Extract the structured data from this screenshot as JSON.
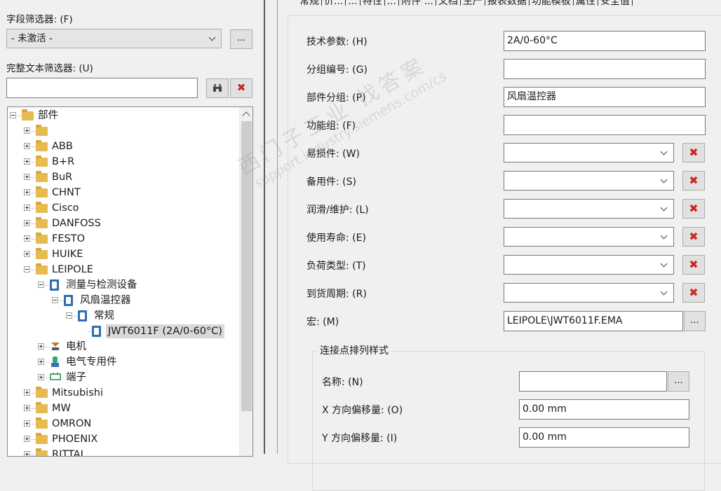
{
  "left": {
    "field_filter": {
      "label": "字段筛选器: (F)",
      "value": "- 未激活 -",
      "more_label": "..."
    },
    "fulltext_filter": {
      "label": "完整文本筛选器: (U)",
      "value": "",
      "binoculars_icon": "binoculars-icon",
      "delete_icon": "✖"
    },
    "tree": [
      {
        "label": "部件",
        "icon": "folder",
        "level": 0,
        "toggle": "minus"
      },
      {
        "label": "",
        "icon": "folder",
        "level": 1,
        "toggle": "plus"
      },
      {
        "label": "ABB",
        "icon": "folder",
        "level": 1,
        "toggle": "plus"
      },
      {
        "label": "B+R",
        "icon": "folder",
        "level": 1,
        "toggle": "plus"
      },
      {
        "label": "BuR",
        "icon": "folder",
        "level": 1,
        "toggle": "plus"
      },
      {
        "label": "CHNT",
        "icon": "folder",
        "level": 1,
        "toggle": "plus"
      },
      {
        "label": "Cisco",
        "icon": "folder",
        "level": 1,
        "toggle": "plus"
      },
      {
        "label": "DANFOSS",
        "icon": "folder",
        "level": 1,
        "toggle": "plus"
      },
      {
        "label": "FESTO",
        "icon": "folder",
        "level": 1,
        "toggle": "plus"
      },
      {
        "label": "HUIKE",
        "icon": "folder",
        "level": 1,
        "toggle": "plus"
      },
      {
        "label": "LEIPOLE",
        "icon": "folder",
        "level": 1,
        "toggle": "minus"
      },
      {
        "label": "测量与检测设备",
        "icon": "part",
        "level": 2,
        "toggle": "minus"
      },
      {
        "label": "风扇温控器",
        "icon": "part",
        "level": 3,
        "toggle": "minus"
      },
      {
        "label": "常规",
        "icon": "part",
        "level": 4,
        "toggle": "minus"
      },
      {
        "label": "JWT6011F (2A/0-60°C)",
        "icon": "part",
        "level": 5,
        "toggle": "none",
        "selected": true
      },
      {
        "label": "电机",
        "icon": "motor",
        "level": 2,
        "toggle": "plus"
      },
      {
        "label": "电气专用件",
        "icon": "electric",
        "level": 2,
        "toggle": "plus"
      },
      {
        "label": "端子",
        "icon": "terminal",
        "level": 2,
        "toggle": "plus"
      },
      {
        "label": "Mitsubishi",
        "icon": "folder",
        "level": 1,
        "toggle": "plus"
      },
      {
        "label": "MW",
        "icon": "folder",
        "level": 1,
        "toggle": "plus"
      },
      {
        "label": "OMRON",
        "icon": "folder",
        "level": 1,
        "toggle": "plus"
      },
      {
        "label": "PHOENIX",
        "icon": "folder",
        "level": 1,
        "toggle": "plus"
      },
      {
        "label": "RITTAL",
        "icon": "folder",
        "level": 1,
        "toggle": "plus"
      }
    ]
  },
  "tabs": [
    "常规",
    "价...",
    "...",
    "特性",
    "...",
    "附件 ...",
    "文档",
    "生产",
    "报表数据",
    "功能模板",
    "属性",
    "安全值"
  ],
  "form": {
    "tech_params": {
      "label": "技术参数: (H)",
      "value": "2A/0-60°C"
    },
    "group_number": {
      "label": "分组编号: (G)",
      "value": ""
    },
    "part_group": {
      "label": "部件分组: (P)",
      "value": "风扇温控器"
    },
    "function_group": {
      "label": "功能组: (F)",
      "value": ""
    },
    "wear_part": {
      "label": "易损件: (W)",
      "value": ""
    },
    "spare_part": {
      "label": "备用件: (S)",
      "value": ""
    },
    "lubrication": {
      "label": "润滑/维护: (L)",
      "value": ""
    },
    "service_life": {
      "label": "使用寿命: (E)",
      "value": ""
    },
    "load_type": {
      "label": "负荷类型: (T)",
      "value": ""
    },
    "delivery_period": {
      "label": "到货周期: (R)",
      "value": ""
    },
    "macro": {
      "label": "宏: (M)",
      "value": "LEIPOLE\\JWT6011F.EMA",
      "more_label": "..."
    },
    "connection_group": {
      "title": "连接点排列样式",
      "name": {
        "label": "名称: (N)",
        "value": "",
        "more_label": "..."
      },
      "x_offset": {
        "label": "X 方向偏移量: (O)",
        "value": "0.00 mm"
      },
      "y_offset": {
        "label": "Y 方向偏移量: (I)",
        "value": "0.00 mm"
      }
    },
    "delete_icon": "✖"
  },
  "watermark": {
    "line1": "西门子工业  找答案",
    "line2": "support.industry.siemens.com/cs"
  }
}
